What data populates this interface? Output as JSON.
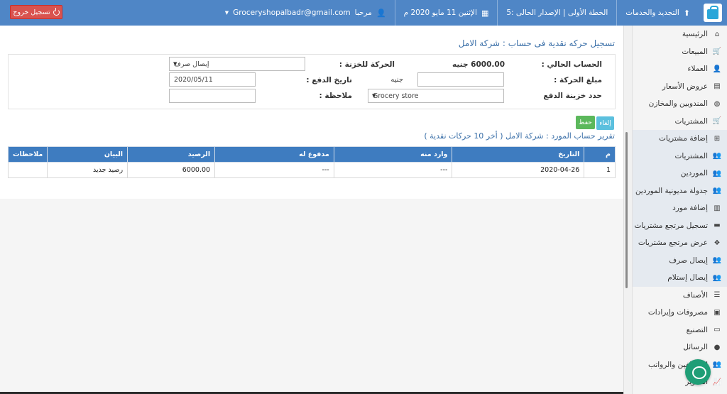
{
  "topbar": {
    "logout_label": "تسجيل خروج",
    "user_email": "Groceryshopalbadr@gmail.com",
    "welcome": "مرحبا",
    "date": "الإثنين 11 مايو 2020 م",
    "plan": "الخطة الأولى | الإصدار الحالى :5",
    "renew": "التجديد والخدمات"
  },
  "sidebar": {
    "items": [
      {
        "label": "الرئيسية",
        "icon": "home-icon",
        "glyph": "⌂",
        "sub": false
      },
      {
        "label": "المبيعات",
        "icon": "cart-icon",
        "glyph": "🛒",
        "sub": false
      },
      {
        "label": "العملاء",
        "icon": "user-icon",
        "glyph": "👤",
        "sub": false
      },
      {
        "label": "عروض الأسعار",
        "icon": "list-icon",
        "glyph": "▤",
        "sub": false
      },
      {
        "label": "المندوبين والمخازن",
        "icon": "globe-icon",
        "glyph": "◍",
        "sub": false
      },
      {
        "label": "المشتريات",
        "icon": "cart-icon",
        "glyph": "🛒",
        "sub": false
      },
      {
        "label": "إضافة مشتريات",
        "icon": "plus-box-icon",
        "glyph": "⊞",
        "sub": true
      },
      {
        "label": "المشتريات",
        "icon": "users-icon",
        "glyph": "👥",
        "sub": true
      },
      {
        "label": "الموردين",
        "icon": "users-icon",
        "glyph": "👥",
        "sub": true
      },
      {
        "label": "جدولة مديونية الموردين",
        "icon": "users-icon",
        "glyph": "👥",
        "sub": true
      },
      {
        "label": "إضافة مورد",
        "icon": "document-icon",
        "glyph": "▥",
        "sub": true
      },
      {
        "label": "تسجيل مرتجع مشتريات",
        "icon": "box-icon",
        "glyph": "▬",
        "sub": true
      },
      {
        "label": "عرض مرتجع مشتريات",
        "icon": "cubes-icon",
        "glyph": "❖",
        "sub": true
      },
      {
        "label": "إيصال صرف",
        "icon": "users-icon",
        "glyph": "👥",
        "sub": true
      },
      {
        "label": "إيصال إستلام",
        "icon": "users-icon",
        "glyph": "👥",
        "sub": true
      },
      {
        "label": "الأصناف",
        "icon": "list-icon",
        "glyph": "☰",
        "sub": false
      },
      {
        "label": "مصروفات وإيرادات",
        "icon": "money-icon",
        "glyph": "▣",
        "sub": false
      },
      {
        "label": "التصنيع",
        "icon": "box-icon",
        "glyph": "▭",
        "sub": false
      },
      {
        "label": "الرسائل",
        "icon": "chat-icon",
        "glyph": "●",
        "sub": false
      },
      {
        "label": "الموظفين والرواتب",
        "icon": "users-icon",
        "glyph": "👥",
        "sub": false
      },
      {
        "label": "التقارير",
        "icon": "chart-icon",
        "glyph": "📈",
        "sub": false
      }
    ]
  },
  "page": {
    "title": "تسجيل حركه نقدية فى حساب : شركة الامل"
  },
  "form": {
    "current_account_label": "الحساب الحالي :",
    "current_account_value": "6000.00 جنيه",
    "treasury_movement_label": "الحركة للخزنة :",
    "treasury_movement_value": "إيصال صرف",
    "amount_label": "مبلغ الحركة :",
    "amount_value": "",
    "currency": "جنيه",
    "payment_date_label": "تاريخ الدفع :",
    "payment_date_value": "2020/05/11",
    "safe_label": "حدد خزينة الدفع",
    "safe_value": "Grocery store",
    "note_label": "ملاحظة :",
    "note_value": ""
  },
  "buttons": {
    "save": "حفظ",
    "cancel": "إلغاء"
  },
  "report": {
    "title": "تقرير حساب المورد : شركة الامل ( أخر 10 حركات نقدية )",
    "columns": [
      "م",
      "التاريخ",
      "وارد منه",
      "مدفوع له",
      "الرصيد",
      "البيان",
      "ملاحظات"
    ],
    "rows": [
      [
        "1",
        "2020-04-26",
        "---",
        "---",
        "6000.00",
        "رصيد جديد",
        ""
      ]
    ]
  }
}
